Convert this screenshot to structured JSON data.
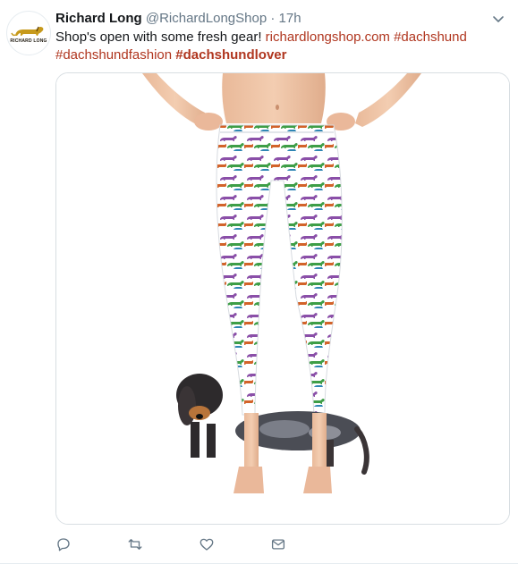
{
  "tweet": {
    "author_name": "Richard Long",
    "handle": "@RichardLongShop",
    "separator": "·",
    "time": "17h",
    "avatar_text": "RICHARD LONG",
    "body_text": "Shop's open with some fresh gear! ",
    "link_url": "richardlongshop.com",
    "hashtag_1": "#dachshund",
    "hashtag_2": "#dachshundfashion",
    "hashtag_3": "#dachshundlover"
  },
  "actions": {
    "icons": [
      "reply-icon",
      "retweet-icon",
      "like-icon",
      "message-icon"
    ]
  },
  "colors": {
    "link": "#b0361f",
    "icon_gray": "#657786",
    "border": "#e6ecf0"
  }
}
